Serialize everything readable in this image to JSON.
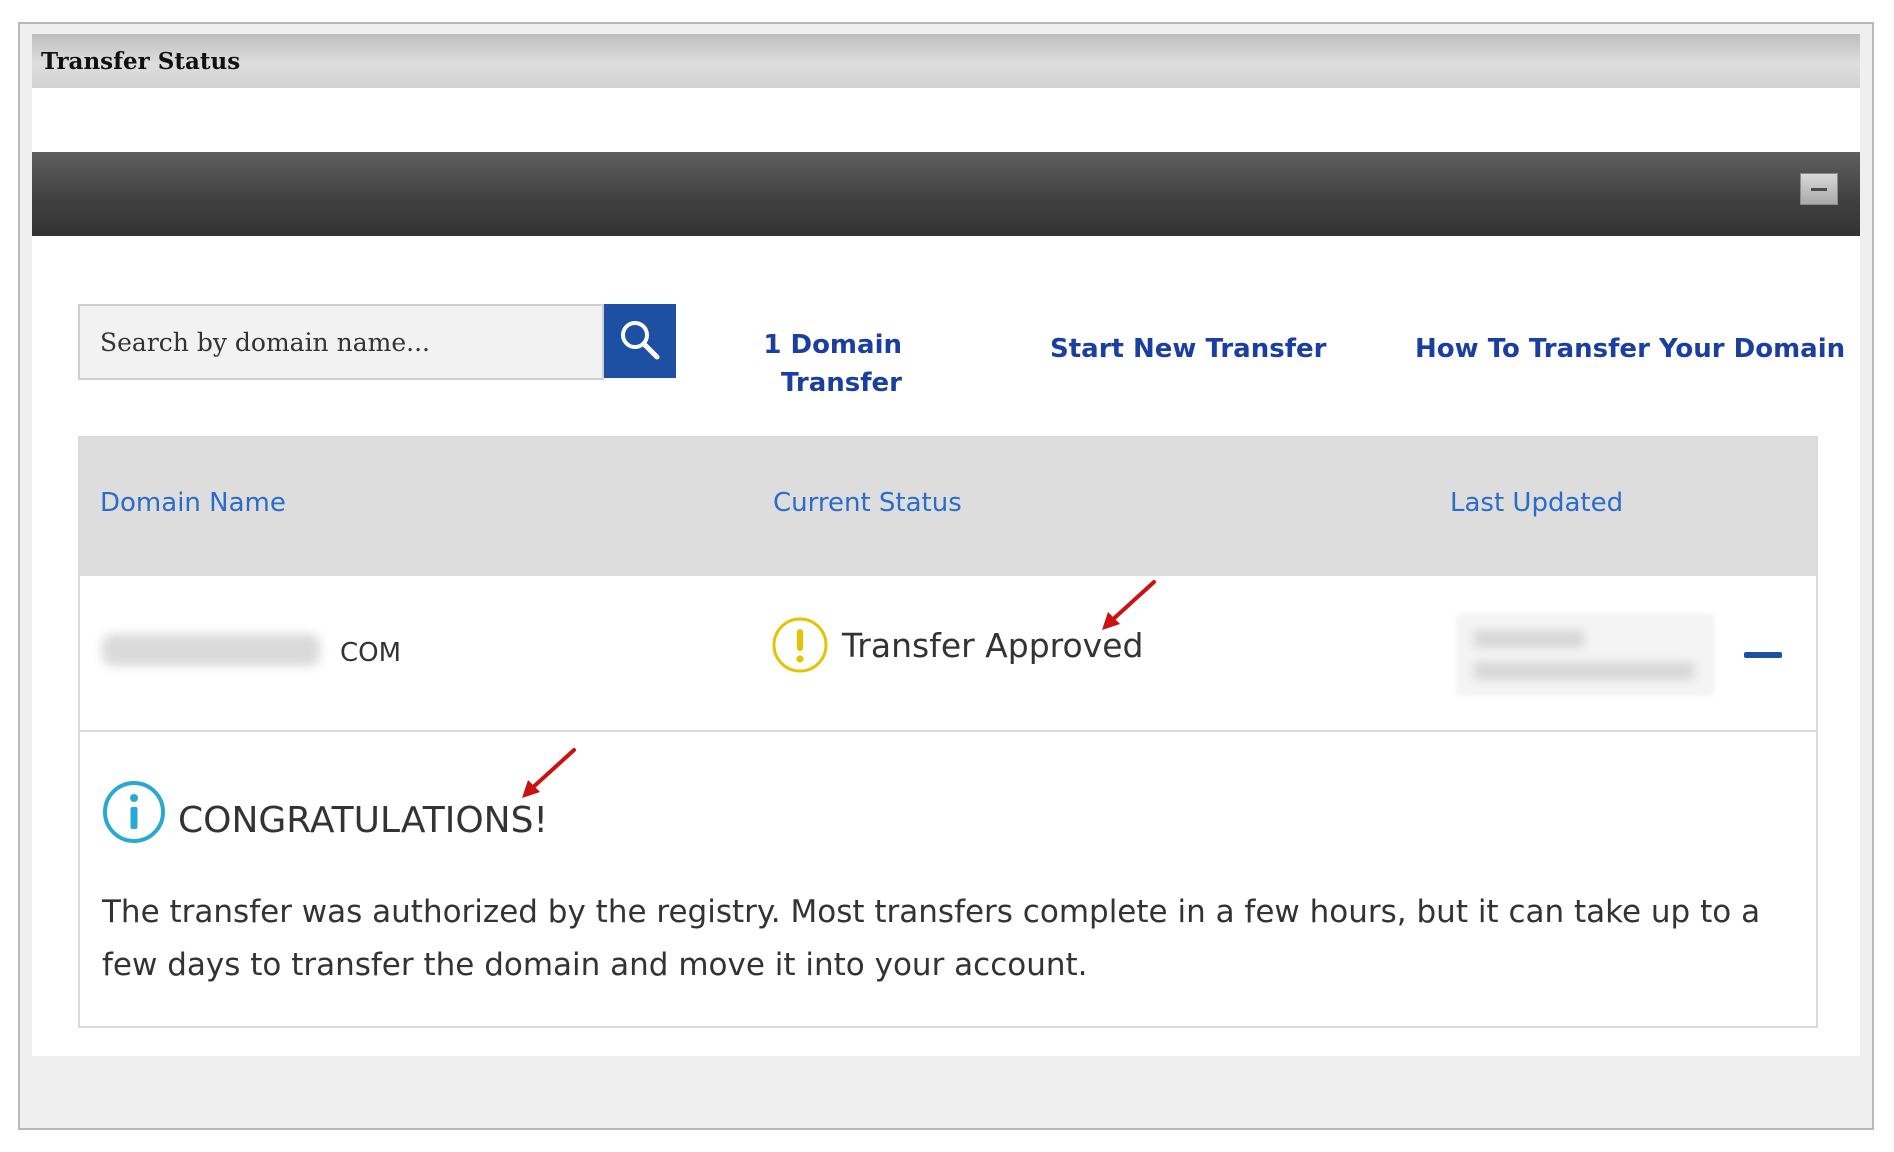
{
  "window": {
    "title": "Transfer Status"
  },
  "toolbar": {
    "collapse_icon": "minus-icon"
  },
  "search": {
    "placeholder": "Search by domain name...",
    "button_icon": "search-icon"
  },
  "links": {
    "count_line1": "1 Domain",
    "count_line2": "Transfer",
    "start_new": "Start New Transfer",
    "how_to": "How To Transfer Your Domain"
  },
  "table": {
    "columns": [
      "Domain Name",
      "Current Status",
      "Last Updated"
    ],
    "rows": [
      {
        "domain_suffix": "COM",
        "status": "Transfer Approved",
        "status_icon": "warning-icon",
        "row_action_icon": "minus-icon"
      }
    ]
  },
  "notice": {
    "icon": "info-icon",
    "title": "CONGRATULATIONS!",
    "message": "The transfer was authorized by the registry. Most transfers complete in a few hours, but it can take up to a few days to transfer the domain and move it into your account."
  },
  "colors": {
    "link": "#1a3fa0",
    "header_link": "#2a6cc7",
    "button": "#1d50a2",
    "warning": "#e6c200",
    "info": "#2aa8d4",
    "annotation_arrow": "#cc1111"
  }
}
